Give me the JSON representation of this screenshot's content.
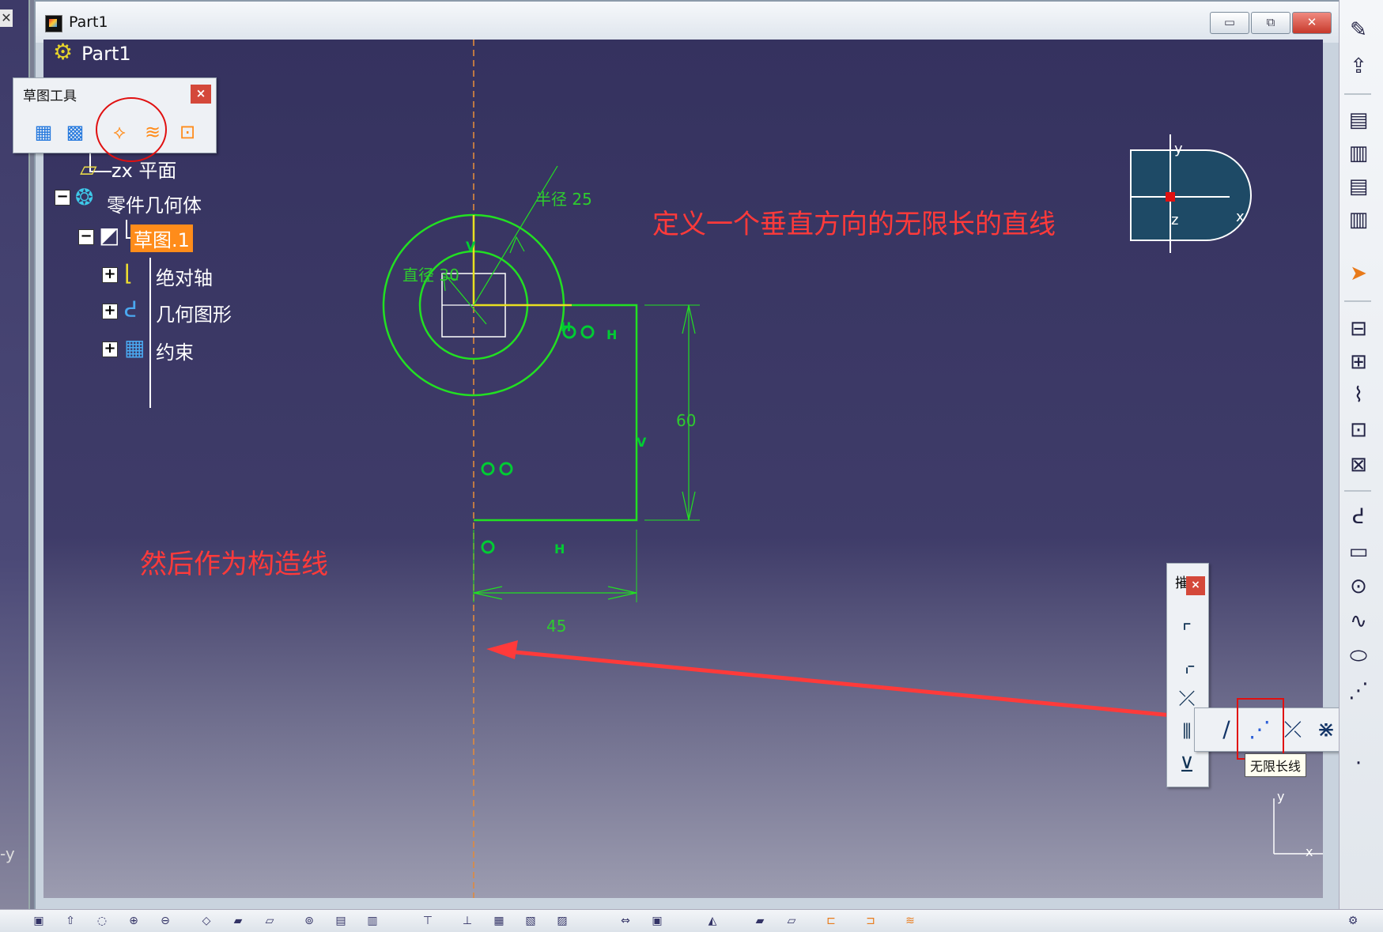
{
  "window": {
    "title": "Part1",
    "min_label": "▭",
    "max_label": "⧉",
    "close_label": "✕"
  },
  "tree": {
    "root": "Part1",
    "zx_plane": "zx 平面",
    "body": "零件几何体",
    "sketch": "草图.1",
    "abs_axis": "绝对轴",
    "geometry": "几何图形",
    "constraints": "约束"
  },
  "sketch_tools": {
    "title": "草图工具",
    "close": "×"
  },
  "sketch": {
    "radius_label": "半径 25",
    "diameter_label": "直径 30",
    "dim_60": "60",
    "dim_45": "45",
    "c_v_top": "V",
    "c_v_right": "V",
    "c_h_top": "H",
    "c_h_bottom": "H",
    "c_h_marker": "H"
  },
  "annotations": {
    "top": "定义一个垂直方向的无限长的直线",
    "left": "然后作为构造线"
  },
  "compass": {
    "x": "x",
    "y": "y",
    "z": "z"
  },
  "corner_axes": {
    "x": "x",
    "y": "y"
  },
  "left_strip": {
    "close": "✕",
    "axis": "-y"
  },
  "sub_toolbar": {
    "title": "摧",
    "close": "×"
  },
  "tooltip": "无限长线",
  "colors": {
    "sketch_green": "#22e022",
    "annotation_red": "#ff3a3a",
    "axis_orange": "#e08a3c"
  }
}
